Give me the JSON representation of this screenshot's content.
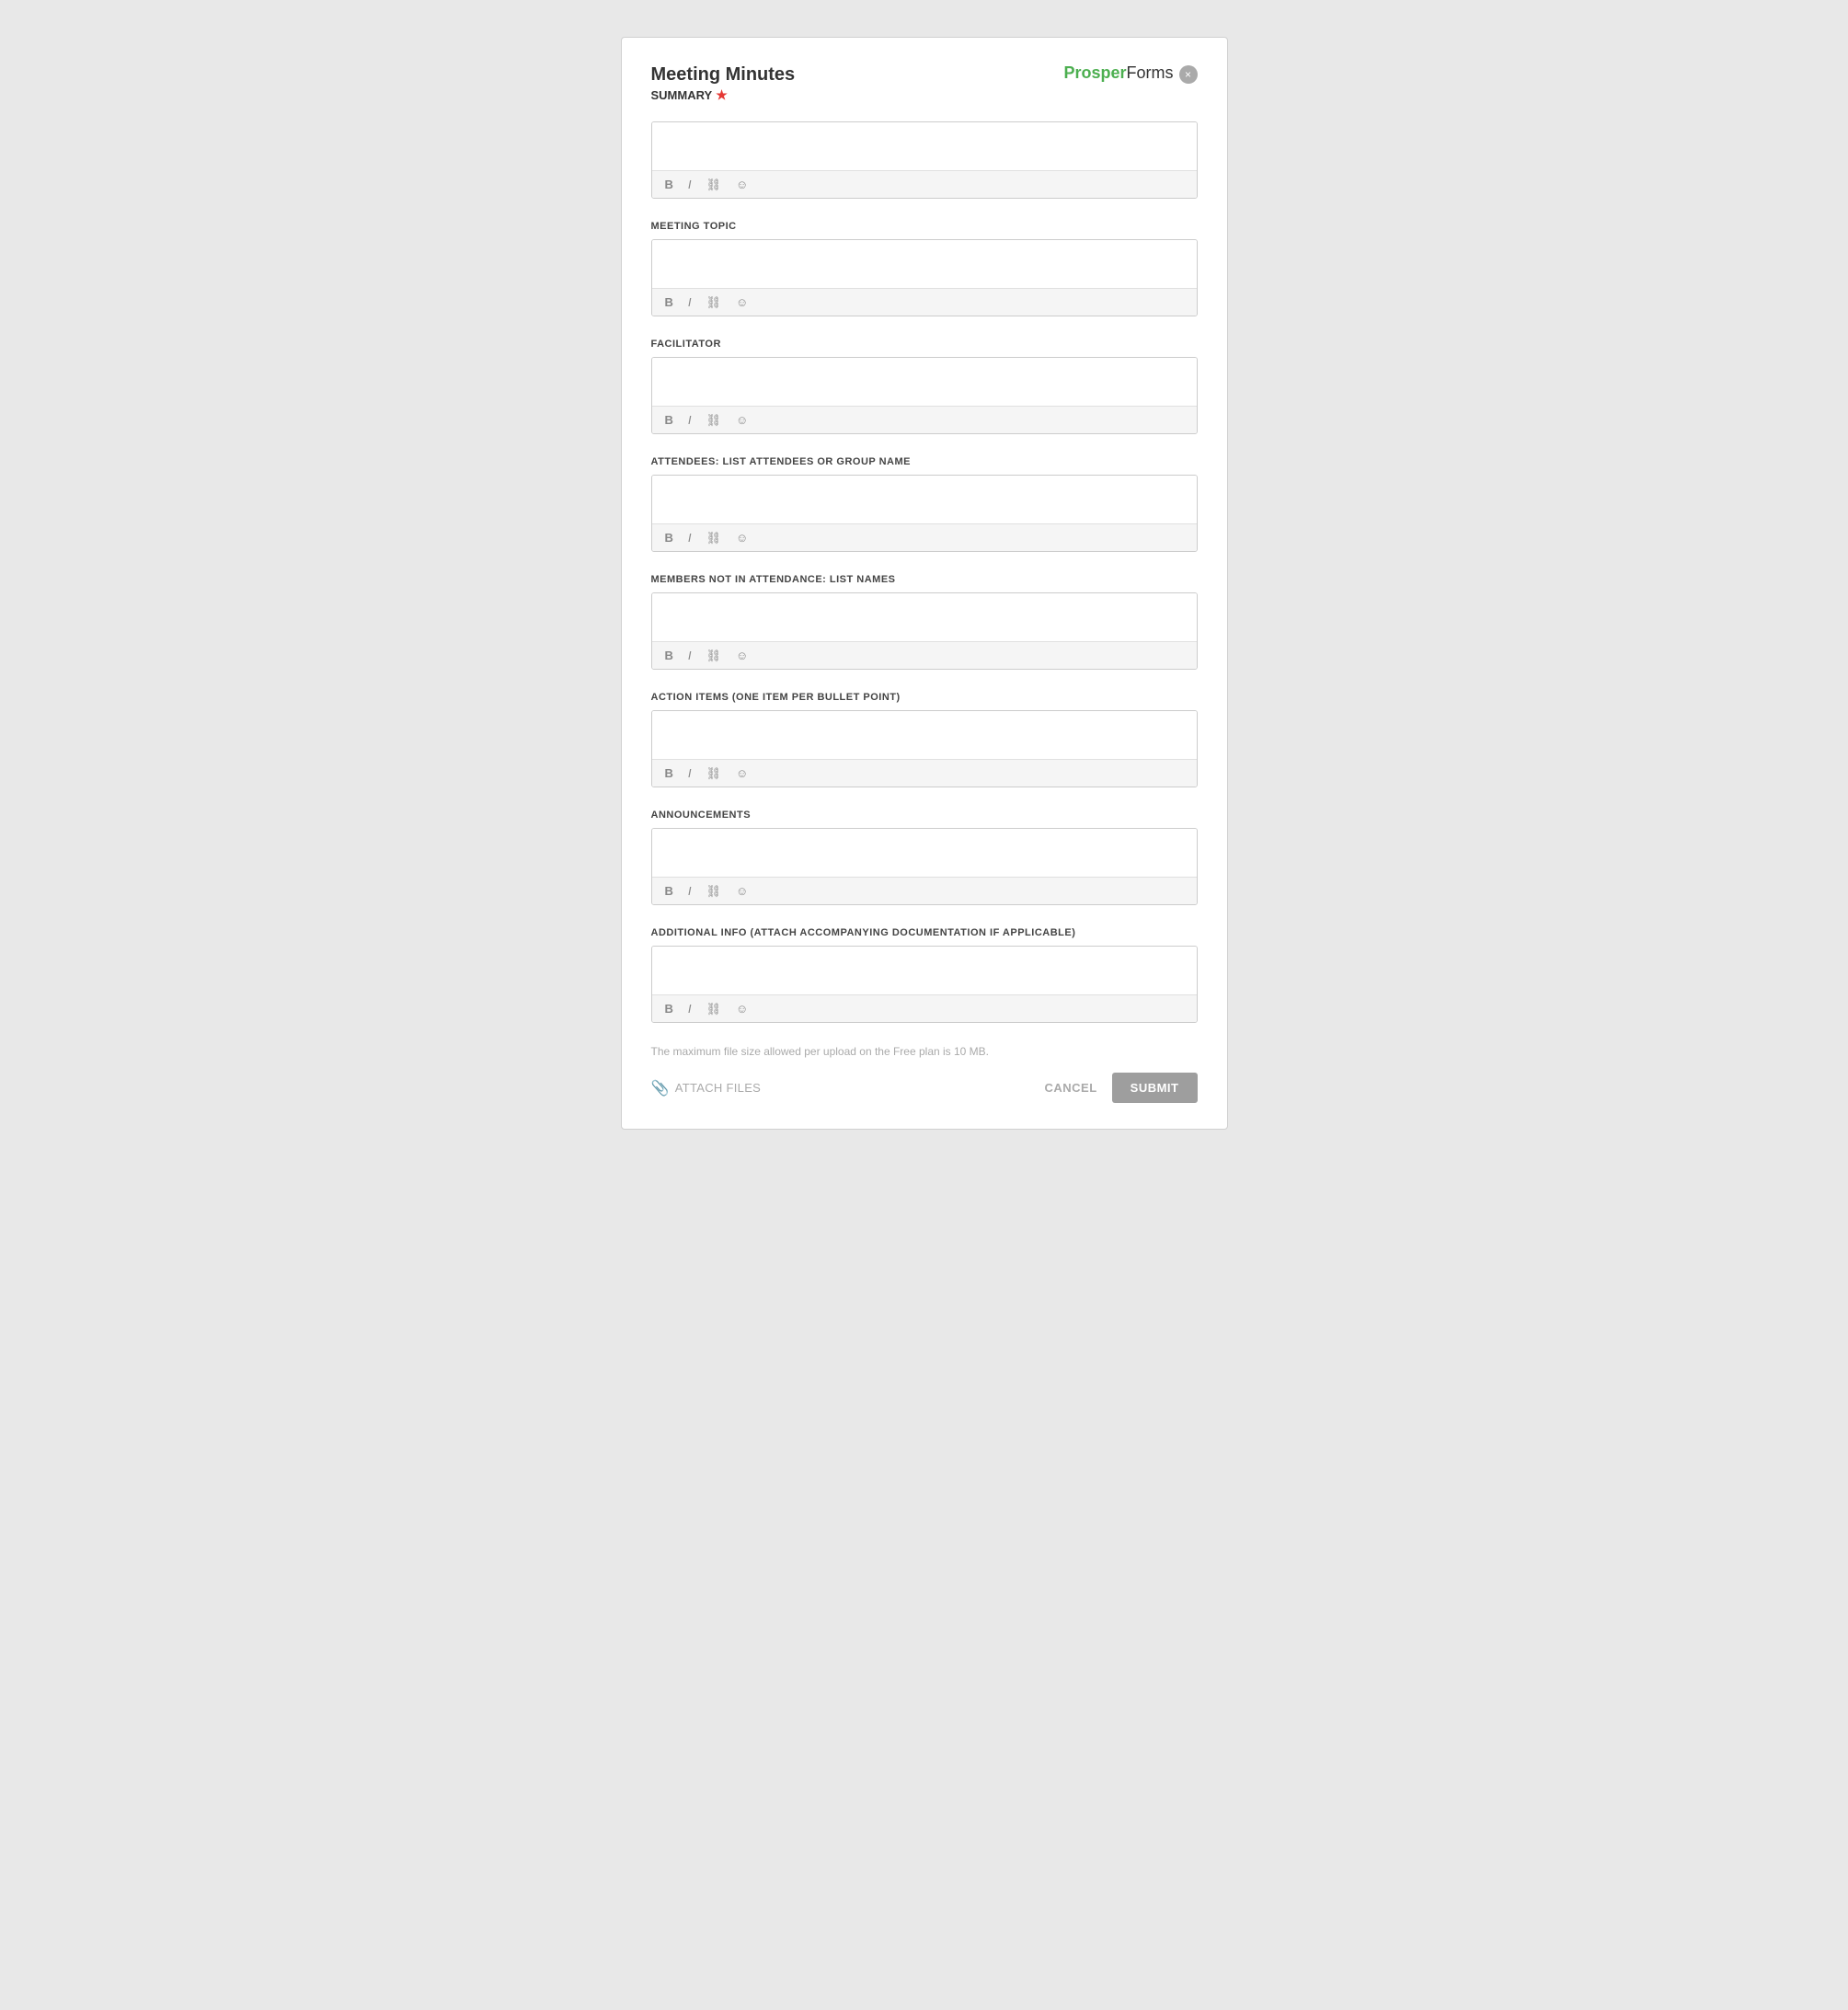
{
  "header": {
    "title": "Meeting Minutes",
    "subtitle": "SUMMARY",
    "required_indicator": "★",
    "logo_prosper": "Prosper",
    "logo_forms": "Forms",
    "close_label": "×"
  },
  "fields": [
    {
      "id": "summary",
      "label": "SUMMARY",
      "required": true,
      "placeholder": ""
    },
    {
      "id": "meeting_topic",
      "label": "MEETING TOPIC",
      "required": false,
      "placeholder": ""
    },
    {
      "id": "facilitator",
      "label": "FACILITATOR",
      "required": false,
      "placeholder": ""
    },
    {
      "id": "attendees",
      "label": "ATTENDEES: LIST ATTENDEES OR GROUP NAME",
      "required": false,
      "placeholder": ""
    },
    {
      "id": "members_not_attending",
      "label": "MEMBERS NOT IN ATTENDANCE: LIST NAMES",
      "required": false,
      "placeholder": ""
    },
    {
      "id": "action_items",
      "label": "ACTION ITEMS (ONE ITEM PER BULLET POINT)",
      "required": false,
      "placeholder": ""
    },
    {
      "id": "announcements",
      "label": "ANNOUNCEMENTS",
      "required": false,
      "placeholder": ""
    },
    {
      "id": "additional_info",
      "label": "ADDITIONAL INFO (ATTACH ACCOMPANYING DOCUMENTATION IF APPLICABLE)",
      "required": false,
      "placeholder": ""
    }
  ],
  "toolbar": {
    "bold": "B",
    "italic": "I",
    "link": "🔗",
    "emoji": "☺"
  },
  "footer": {
    "file_size_note": "The maximum file size allowed per upload on the Free plan is 10 MB.",
    "attach_label": "ATTACH FILES",
    "cancel_label": "CANCEL",
    "submit_label": "SUBMIT"
  }
}
